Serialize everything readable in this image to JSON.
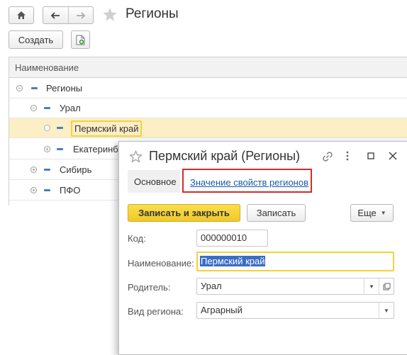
{
  "window": {
    "title": "Регионы",
    "create_label": "Создать"
  },
  "table": {
    "column_header": "Наименование",
    "rows": [
      {
        "label": "Регионы"
      },
      {
        "label": "Урал"
      },
      {
        "label": "Пермский край"
      },
      {
        "label": "Екатеринбург"
      },
      {
        "label": "Сибирь"
      },
      {
        "label": "ПФО"
      }
    ]
  },
  "form": {
    "title": "Пермский край (Регионы)",
    "tabs": [
      "Основное",
      "Значение свойств регионов"
    ],
    "buttons": {
      "save_close": "Записать и закрыть",
      "save": "Записать",
      "more": "Еще"
    },
    "fields": {
      "code_label": "Код:",
      "code_value": "000000010",
      "name_label": "Наименование:",
      "name_value": "Пермский край",
      "parent_label": "Родитель:",
      "parent_value": "Урал",
      "kind_label": "Вид региона:",
      "kind_value": "Аграрный"
    }
  },
  "colors": {
    "accent_yellow": "#f5d13a",
    "selected_row": "#fcefc6",
    "link_blue": "#1d5aa7",
    "highlight_red": "#d22c2c",
    "selection_blue": "#3a6dc5"
  }
}
